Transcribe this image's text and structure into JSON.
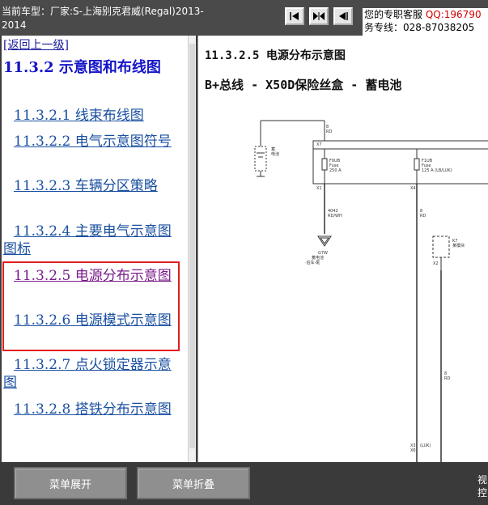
{
  "header": {
    "model_line1": "当前车型：厂家:S-上海别克君威(Regal)2013-",
    "model_line2": "2014",
    "service_label": "您的专职客服",
    "service_qq": "QQ:196790",
    "service_phone": "务专线：028-87038205"
  },
  "nav": {
    "back": "[返回上一级]",
    "section_title": "11.3.2 示意图和布线图",
    "items": [
      {
        "label": "11.3.2.1 线束布线图"
      },
      {
        "label": "11.3.2.2 电气示意图符号"
      },
      {
        "label": "11.3.2.3 车辆分区策略"
      },
      {
        "label": "11.3.2.4 主要电气示意图图标"
      },
      {
        "label": "11.3.2.5 电源分布示意图"
      },
      {
        "label": "11.3.2.6 电源模式示意图"
      },
      {
        "label": "11.3.2.7 点火锁定器示意图"
      },
      {
        "label": "11.3.2.8 搭铁分布示意图"
      }
    ]
  },
  "content": {
    "title": "11.3.2.5 电源分布示意图",
    "subtitle": "B+总线 - X50D保险丝盒 - 蓄电池"
  },
  "footer": {
    "expand": "菜单展开",
    "collapse": "菜单折叠",
    "corner": "视控"
  },
  "colors": {
    "highlight_border": "#e02020",
    "link": "#1a4fa0",
    "visited": "#7a1a8a"
  }
}
